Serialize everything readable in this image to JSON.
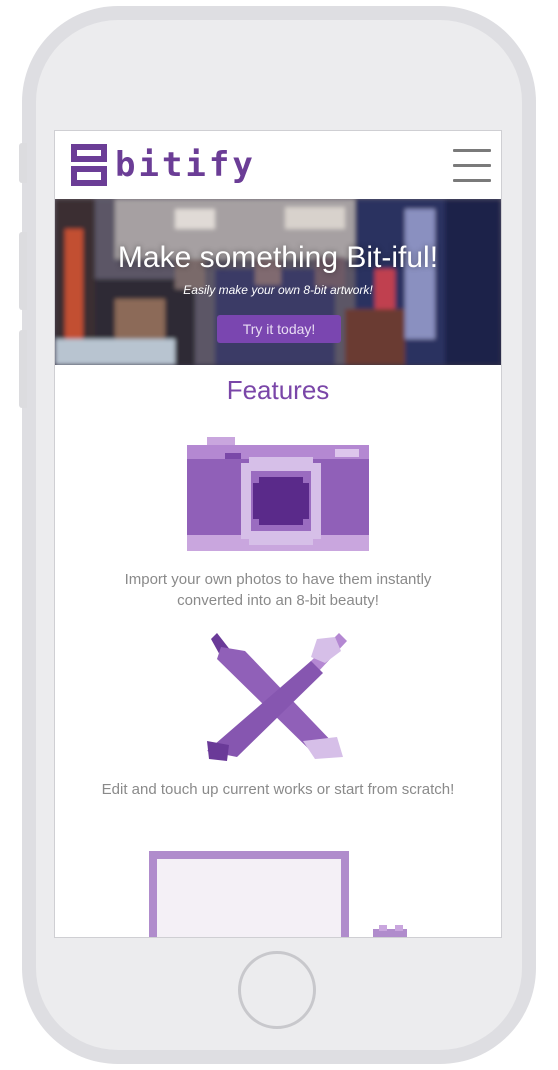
{
  "app": {
    "logo_text": "bitify",
    "brand_color": "#6b3d96",
    "accent_color": "#7a46b0"
  },
  "header": {
    "logo_icon": "8-pixel-logo-icon",
    "menu_icon": "hamburger-menu-icon"
  },
  "hero": {
    "title": "Make something Bit-iful!",
    "subtitle": "Easily make your own 8-bit artwork!",
    "cta_label": "Try it today!"
  },
  "features": {
    "title": "Features",
    "items": [
      {
        "icon": "pixel-camera-icon",
        "text": "Import your own photos to have them instantly converted into an 8-bit beauty!"
      },
      {
        "icon": "pixel-pencil-brush-icon",
        "text": "Edit and touch up current works or start from scratch!"
      },
      {
        "icon": "pixel-canvas-icon",
        "text": ""
      }
    ]
  }
}
